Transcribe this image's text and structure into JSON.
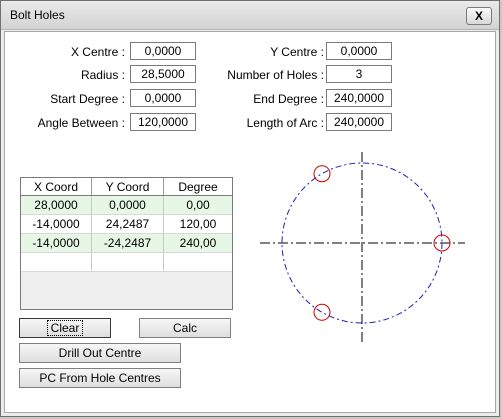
{
  "window": {
    "title": "Bolt Holes",
    "close_symbol": "X"
  },
  "fields": {
    "x_centre": {
      "label": "X Centre :",
      "value": "0,0000"
    },
    "y_centre": {
      "label": "Y Centre :",
      "value": "0,0000"
    },
    "radius": {
      "label": "Radius :",
      "value": "28,5000"
    },
    "number_of_holes": {
      "label": "Number of Holes :",
      "value": "3"
    },
    "start_degree": {
      "label": "Start Degree :",
      "value": "0,0000"
    },
    "end_degree": {
      "label": "End Degree :",
      "value": "240,0000"
    },
    "angle_between": {
      "label": "Angle Between :",
      "value": "120,0000"
    },
    "length_of_arc": {
      "label": "Length of Arc :",
      "value": "240,0000"
    }
  },
  "table": {
    "columns": [
      "X Coord",
      "Y Coord",
      "Degree"
    ],
    "rows": [
      [
        "28,0000",
        "0,0000",
        "0,00"
      ],
      [
        "-14,0000",
        "24,2487",
        "120,00"
      ],
      [
        "-14,0000",
        "-24,2487",
        "240,00"
      ],
      [
        "",
        "",
        ""
      ]
    ]
  },
  "buttons": {
    "clear": "Clear",
    "calc": "Calc",
    "drill_out_centre": "Drill Out Centre",
    "pc_from_hole_centres": "PC From Hole Centres"
  },
  "preview": {
    "hole_angles_deg": [
      0,
      120,
      240
    ],
    "bolt_circle_color": "#1f1fb8",
    "centerline_color": "#000000",
    "hole_color": "#cc0000"
  }
}
